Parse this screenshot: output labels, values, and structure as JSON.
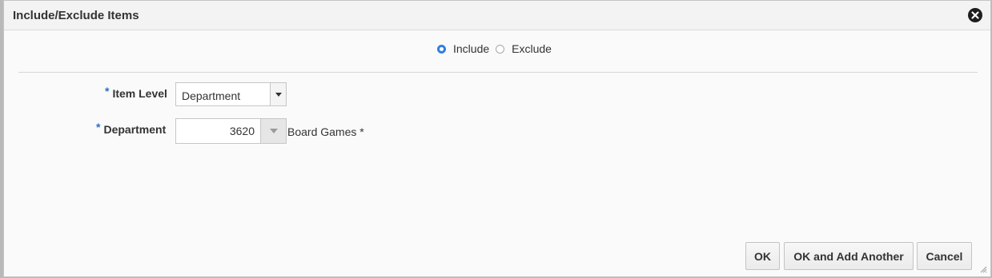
{
  "dialog": {
    "title": "Include/Exclude Items"
  },
  "mode": {
    "options": [
      {
        "label": "Include",
        "selected": true
      },
      {
        "label": "Exclude",
        "selected": false
      }
    ]
  },
  "form": {
    "required_marker": "*",
    "item_level": {
      "label": "Item Level",
      "value": "Department"
    },
    "department": {
      "label": "Department",
      "value": "3620",
      "description": "Board Games *"
    }
  },
  "buttons": {
    "ok": "OK",
    "ok_add": "OK and Add Another",
    "cancel": "Cancel"
  },
  "colors": {
    "accent": "#2f7fe0",
    "required": "#2b6fc6"
  }
}
